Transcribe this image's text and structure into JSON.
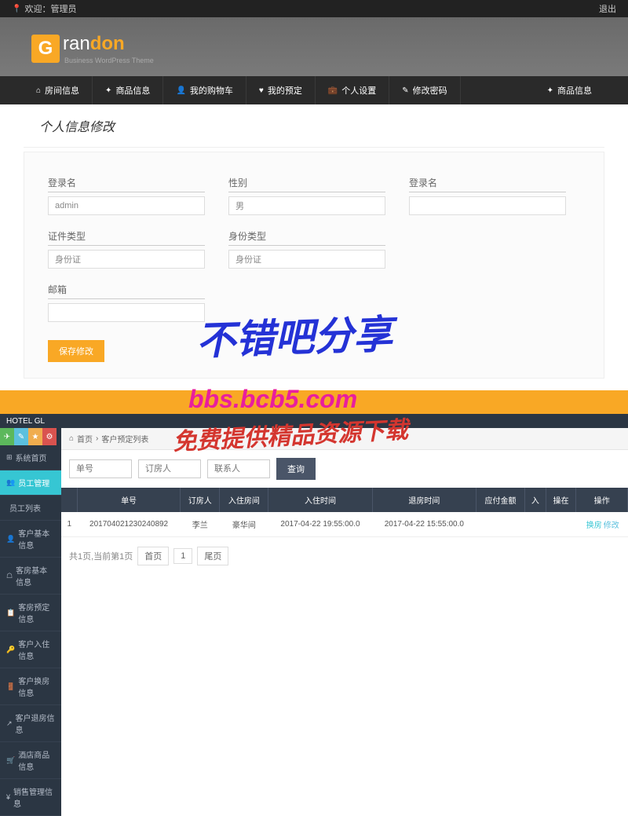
{
  "adminBar": {
    "welcome": "欢迎：管理员",
    "logout": "退出"
  },
  "logo": {
    "g": "G",
    "rest": "ran",
    "em": "don",
    "sub": "Business WordPress Theme"
  },
  "nav": [
    {
      "icon": "⌂",
      "label": "房间信息"
    },
    {
      "icon": "✦",
      "label": "商品信息"
    },
    {
      "icon": "👤",
      "label": "我的购物车"
    },
    {
      "icon": "♥",
      "label": "我的预定"
    },
    {
      "icon": "💼",
      "label": "个人设置"
    },
    {
      "icon": "✎",
      "label": "修改密码"
    },
    {
      "icon": "✦",
      "label": "商品信息"
    }
  ],
  "pageTitle": "个人信息修改",
  "form": {
    "row1": [
      {
        "label": "登录名",
        "value": "admin"
      },
      {
        "label": "性别",
        "value": "男"
      },
      {
        "label": "登录名",
        "value": ""
      }
    ],
    "row2": [
      {
        "label": "证件类型",
        "value": "身份证"
      },
      {
        "label": "身份类型",
        "value": "身份证"
      }
    ],
    "row3": [
      {
        "label": "邮箱",
        "value": ""
      }
    ],
    "submit": "保存修改"
  },
  "hotel": {
    "title": "HOTEL GL",
    "breadcrumb": {
      "home": "首页",
      "sep": "›",
      "current": "客户预定列表"
    },
    "sidebar": [
      {
        "icon": "⊞",
        "label": "系统首页"
      },
      {
        "icon": "👥",
        "label": "员工管理",
        "active": true
      },
      {
        "icon": "",
        "label": "员工列表"
      },
      {
        "icon": "👤",
        "label": "客户基本信息"
      },
      {
        "icon": "☖",
        "label": "客房基本信息"
      },
      {
        "icon": "📋",
        "label": "客房预定信息"
      },
      {
        "icon": "🔑",
        "label": "客户入住信息"
      },
      {
        "icon": "🚪",
        "label": "客户换房信息"
      },
      {
        "icon": "↗",
        "label": "客户退房信息"
      },
      {
        "icon": "🛒",
        "label": "酒店商品信息"
      },
      {
        "icon": "¥",
        "label": "销售管理信息"
      }
    ],
    "search": {
      "ph1": "单号",
      "ph2": "订房人",
      "ph3": "联系人",
      "btn": "查询"
    },
    "table": {
      "headers": [
        "",
        "单号",
        "订房人",
        "入住房间",
        "入住时间",
        "退房时间",
        "应付金额",
        "入",
        "操在",
        "操作"
      ],
      "row": {
        "idx": "1",
        "orderNo": "201704021230240892",
        "person": "李兰",
        "room": "豪华间",
        "checkin": "2017-04-22 19:55:00.0",
        "checkout": "2017-04-22 15:55:00.0",
        "amount": "",
        "c7": "",
        "c8": "",
        "op1": "换房",
        "op2": "修改"
      }
    },
    "pagination": {
      "info": "共1页,当前第1页",
      "first": "首页",
      "num": "1",
      "last": "尾页"
    }
  },
  "watermark": {
    "t1": "不错吧分享",
    "t2": "bbs.bcb5.com",
    "t3": "免费提供精品资源下载"
  }
}
